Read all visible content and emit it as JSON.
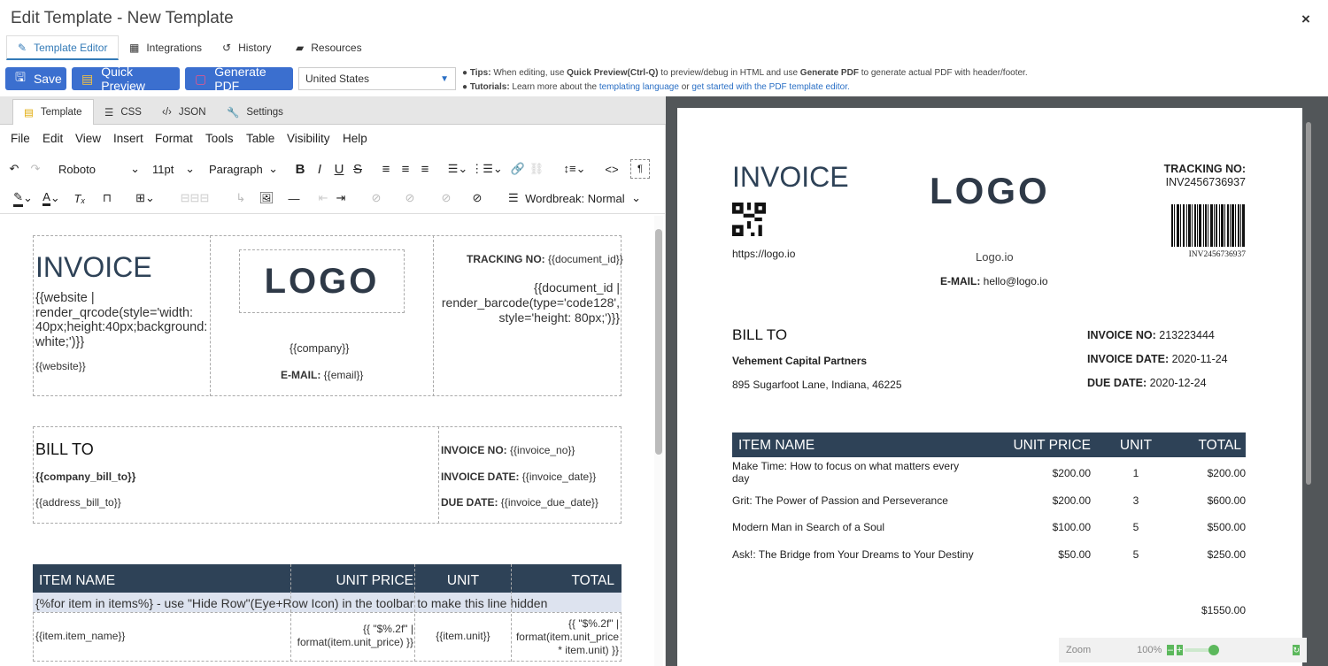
{
  "window": {
    "title": "Edit Template - New Template",
    "close": "×"
  },
  "top_tabs": [
    "Template Editor",
    "Integrations",
    "History",
    "Resources"
  ],
  "actions": {
    "save": "Save",
    "quick_preview": "Quick Preview",
    "generate_pdf": "Generate PDF",
    "country": "United States"
  },
  "tips": {
    "line1_prefix": "Tips:",
    "line1_text": " When editing, use ",
    "line1_b1": "Quick Preview(Ctrl-Q)",
    "line1_mid": " to preview/debug in HTML and use ",
    "line1_b2": "Generate PDF",
    "line1_end": " to generate actual PDF with header/footer.",
    "line2_prefix": "Tutorials:",
    "line2_text": " Learn more about the ",
    "line2_link1": "templating language",
    "line2_or": " or ",
    "line2_link2": "get started with the PDF template editor."
  },
  "sub_tabs": [
    "Template",
    "CSS",
    "JSON",
    "Settings"
  ],
  "menu": [
    "File",
    "Edit",
    "View",
    "Insert",
    "Format",
    "Tools",
    "Table",
    "Visibility",
    "Help"
  ],
  "toolbar": {
    "font": "Roboto",
    "size": "11pt",
    "block": "Paragraph",
    "wordbreak": "Wordbreak: Normal"
  },
  "editor": {
    "invoice": "INVOICE",
    "qr_code": "{{website | render_qrcode(style='width: 40px;height:40px;background: white;')}}",
    "website": "{{website}}",
    "logo": "LOGO",
    "company": "{{company}}",
    "email_label": "E-MAIL:",
    "email": "{{email}}",
    "tracking_label": "TRACKING NO:",
    "tracking": "{{document_id}}",
    "barcode": "{{document_id | render_barcode(type='code128', style='height: 80px;')}}",
    "bill_to": "BILL TO",
    "company_bill_to": "{{company_bill_to}}",
    "address_bill_to": "{{address_bill_to}}",
    "invoice_no_label": "INVOICE NO:",
    "invoice_no": "{{invoice_no}}",
    "invoice_date_label": "INVOICE DATE:",
    "invoice_date": "{{invoice_date}}",
    "due_date_label": "DUE DATE:",
    "due_date": "{{invoice_due_date}}",
    "col_item": "ITEM NAME",
    "col_price": "UNIT PRICE",
    "col_unit": "UNIT",
    "col_total": "TOTAL",
    "loop_row": "{%for item in items%} - use \"Hide Row\"(Eye+Row Icon) in the toolbar to make this line hidden",
    "item_name": "{{item.item_name}}",
    "item_price": "{{ \"$%.2f\" | format(item.unit_price) }}",
    "item_unit": "{{item.unit}}",
    "item_total": "{{ \"$%.2f\" | format(item.unit_price * item.unit) }}"
  },
  "preview": {
    "invoice": "INVOICE",
    "logo": "LOGO",
    "tracking_label": "TRACKING NO:",
    "tracking": "INV2456736937",
    "barcode_text": "INV2456736937",
    "website": "https://logo.io",
    "company": "Logo.io",
    "email_label": "E-MAIL:",
    "email": "hello@logo.io",
    "bill_to": "BILL TO",
    "company_bill_to": "Vehement Capital Partners",
    "address_bill_to": "895 Sugarfoot Lane, Indiana, 46225",
    "invoice_no_label": "INVOICE NO:",
    "invoice_no": "213223444",
    "invoice_date_label": "INVOICE DATE:",
    "invoice_date": "2020-11-24",
    "due_date_label": "DUE DATE:",
    "due_date": "2020-12-24",
    "columns": [
      "ITEM NAME",
      "UNIT PRICE",
      "UNIT",
      "TOTAL"
    ],
    "items": [
      {
        "name": "Make Time: How to focus on what matters every day",
        "price": "$200.00",
        "unit": "1",
        "total": "$200.00"
      },
      {
        "name": "Grit: The Power of Passion and Perseverance",
        "price": "$200.00",
        "unit": "3",
        "total": "$600.00"
      },
      {
        "name": "Modern Man in Search of a Soul",
        "price": "$100.00",
        "unit": "5",
        "total": "$500.00"
      },
      {
        "name": "Ask!: The Bridge from Your Dreams to Your Destiny",
        "price": "$50.00",
        "unit": "5",
        "total": "$250.00"
      }
    ],
    "grand_total": "$1550.00"
  },
  "zoom": {
    "label": "Zoom",
    "value": "100%"
  }
}
